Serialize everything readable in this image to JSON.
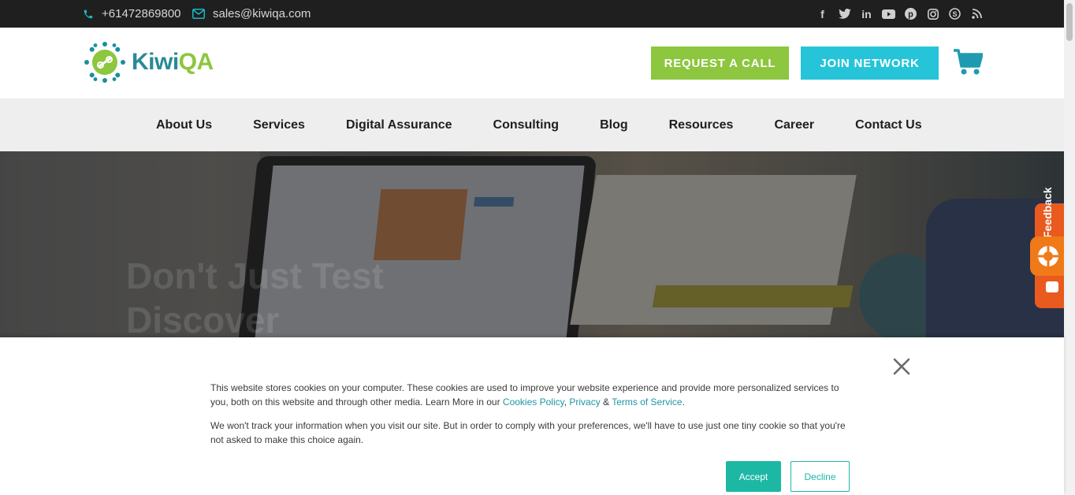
{
  "topbar": {
    "phone": "+61472869800",
    "email": "sales@kiwiqa.com",
    "social_icons": [
      "facebook-icon",
      "twitter-icon",
      "linkedin-icon",
      "youtube-icon",
      "pinterest-icon",
      "instagram-icon",
      "skype-icon",
      "rss-icon"
    ]
  },
  "header": {
    "logo": {
      "part1": "Kiwi",
      "part2": "QA"
    },
    "request_call_label": "REQUEST A CALL",
    "join_network_label": "JOIN NETWORK",
    "cart_icon": "shopping-cart-icon"
  },
  "nav": {
    "items": [
      "About Us",
      "Services",
      "Digital Assurance",
      "Consulting",
      "Blog",
      "Resources",
      "Career",
      "Contact Us"
    ]
  },
  "hero": {
    "title_line1": "Don't Just Test",
    "title_line2": "Discover"
  },
  "feedback": {
    "label": "Feedback"
  },
  "cookie": {
    "text1_before": "This website stores cookies on your computer. These cookies are used to improve your website experience and provide more personalized services to you, both on this website and through other media. Learn More in our ",
    "cookies_policy": "Cookies Policy",
    "sep1": ", ",
    "privacy": "Privacy",
    "sep2": " & ",
    "terms": "Terms of Service",
    "end": ".",
    "text2": "We won't track your information when you visit our site. But in order to comply with your preferences, we'll have to use just one tiny cookie so that you're not asked to make this choice again.",
    "accept_label": "Accept",
    "decline_label": "Decline"
  },
  "colors": {
    "topbar_bg": "#1f1f1f",
    "accent_teal": "#1ab6c1",
    "brand_green": "#8dc63f",
    "brand_cyan": "#26c4d9",
    "nav_bg": "#eeeeee",
    "cookie_accept": "#1cb8a4",
    "feedback_orange": "#e95a1f"
  }
}
